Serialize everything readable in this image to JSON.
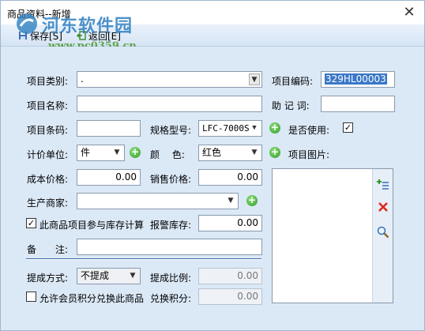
{
  "window": {
    "title": "商品资料--新增",
    "close_glyph": "✕"
  },
  "watermark": {
    "site_name": "河东软件园",
    "url": "www.pc0359.cn"
  },
  "toolbar": {
    "save_label": "保存[S]",
    "back_label": "返回[E]"
  },
  "form": {
    "category": {
      "label": "项目类别:",
      "value": "."
    },
    "code": {
      "label": "项目编码:",
      "value": "329HL00003"
    },
    "name": {
      "label": "项目名称:",
      "value": ""
    },
    "mnemonic": {
      "label": "助 记 词:",
      "value": ""
    },
    "barcode": {
      "label": "项目条码:",
      "value": ""
    },
    "model": {
      "label": "规格型号:",
      "value": "LFC-7000S"
    },
    "in_use": {
      "label": "是否使用:",
      "checked": true
    },
    "unit": {
      "label": "计价单位:",
      "value": "件"
    },
    "color": {
      "label": "颜　 色:",
      "value": "红色"
    },
    "image": {
      "label": "项目图片:"
    },
    "cost_price": {
      "label": "成本价格:",
      "value": "0.00"
    },
    "sale_price": {
      "label": "销售价格:",
      "value": "0.00"
    },
    "manufacturer": {
      "label": "生产商家:",
      "value": ""
    },
    "stock_calc": {
      "label": "此商品项目参与库存计算",
      "checked": true
    },
    "alert_stock": {
      "label": "报警库存:",
      "value": "0.00"
    },
    "remark": {
      "label": "备　　注:",
      "value": ""
    },
    "commission_mode": {
      "label": "提成方式:",
      "value": "不提成"
    },
    "commission_ratio": {
      "label": "提成比例:",
      "value": "0.00"
    },
    "allow_points": {
      "label": "允许会员积分兑换此商品",
      "checked": false
    },
    "points": {
      "label": "兑换积分:",
      "value": "0.00"
    }
  },
  "check_glyph": "✓",
  "arrow_glyph": "▼",
  "colors": {
    "accent": "#3a77c8",
    "background": "#dbe8f6",
    "add_green": "#2f9b2a",
    "delete_red": "#e0261b"
  }
}
